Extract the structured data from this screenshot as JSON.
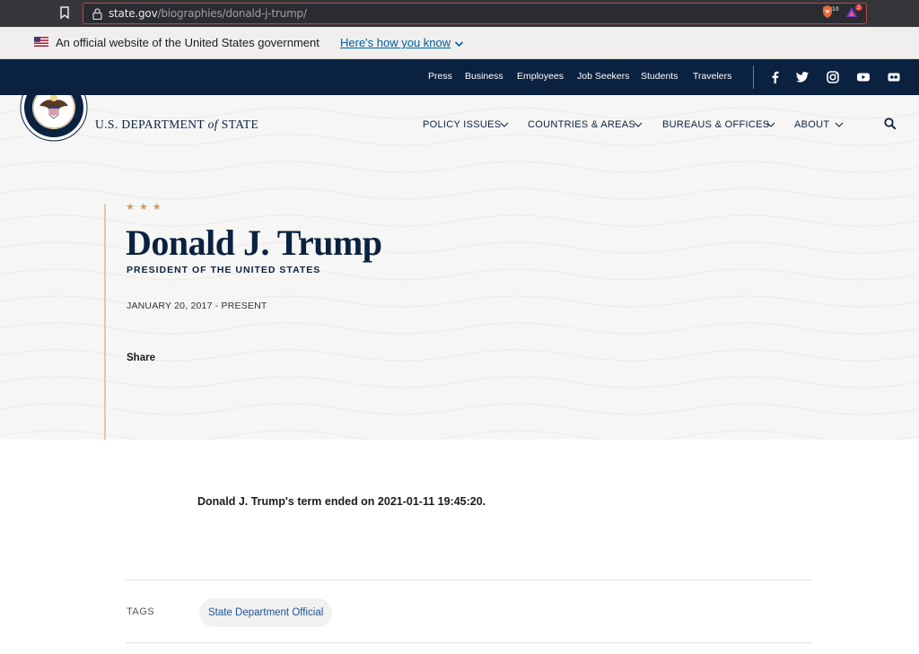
{
  "browser": {
    "url_domain": "state.gov",
    "url_path": "/biographies/donald-j-trump/",
    "shield_badge": "10",
    "alert_badge": "2",
    "colors": {
      "frame": "#35363a",
      "url_border": "#b94646"
    }
  },
  "gov_banner": {
    "text": "An official website of the United States government",
    "link": "Here's how you know"
  },
  "top_nav": {
    "items": [
      "Press",
      "Business",
      "Employees",
      "Job Seekers",
      "Students",
      "Travelers"
    ],
    "social": [
      "facebook-icon",
      "twitter-icon",
      "instagram-icon",
      "youtube-icon",
      "flickr-icon"
    ]
  },
  "header": {
    "org_name_pre": "U.S. DEPARTMENT",
    "org_name_of": "of",
    "org_name_post": "STATE",
    "nav": [
      {
        "label": "POLICY ISSUES"
      },
      {
        "label": "COUNTRIES & AREAS"
      },
      {
        "label": "BUREAUS & OFFICES"
      },
      {
        "label": "ABOUT"
      }
    ]
  },
  "hero": {
    "stars": "★★★",
    "title": "Donald J. Trump",
    "subtitle": "PRESIDENT OF THE UNITED STATES",
    "dates": "JANUARY 20, 2017 - PRESENT",
    "share": "Share"
  },
  "content": {
    "term_text": "Donald J. Trump's term ended on 2021-01-11 19:45:20.",
    "tags_label": "TAGS",
    "tags": [
      "State Department Official"
    ]
  },
  "colors": {
    "navy": "#0a2240",
    "accent": "#c99b6a",
    "link": "#005ea2"
  }
}
